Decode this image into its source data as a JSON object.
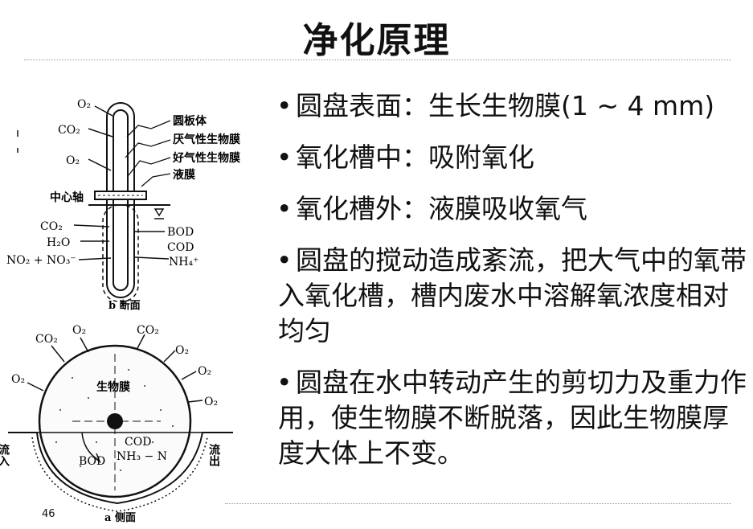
{
  "slide": {
    "title": "净化原理",
    "page_number": "46"
  },
  "bullets": [
    "圆盘表面：生长生物膜(1 ~ 4 mm)",
    "氧化槽中：吸附氧化",
    "氧化槽外：液膜吸收氧气",
    "圆盘的搅动造成紊流，把大气中的氧带入氧化槽，槽内废水中溶解氧浓度相对均匀",
    "圆盘在水中转动产生的剪切力及重力作用，使生物膜不断脱落，因此生物膜厚度大体上不变。"
  ],
  "diagram_b": {
    "caption": "b 断面",
    "o2_top": "O₂",
    "co2_left": "CO₂",
    "o2_left": "O₂",
    "label_disk": "圆板体",
    "label_anaerobic": "厌气性生物膜",
    "label_aerobic": "好气性生物膜",
    "label_liquid": "液膜",
    "label_axis": "中心轴",
    "co2_bottom": "CO₂",
    "h2o": "H₂O",
    "no": "NO₂ + NO₃⁻",
    "bod": "BOD",
    "cod": "COD",
    "nh4": "NH₄⁺"
  },
  "diagram_a": {
    "caption": "a 侧面",
    "biofilm": "生物膜",
    "co2_1": "CO₂",
    "o2_1": "O₂",
    "co2_2": "CO₂",
    "o2_2": "O₂",
    "o2_3": "O₂",
    "o2_4": "O₂",
    "o2_left": "O₂",
    "inflow": "流入",
    "outflow": "流出",
    "bod": "BOD",
    "cod": "COD",
    "nh3n": "NH₃ − N"
  }
}
